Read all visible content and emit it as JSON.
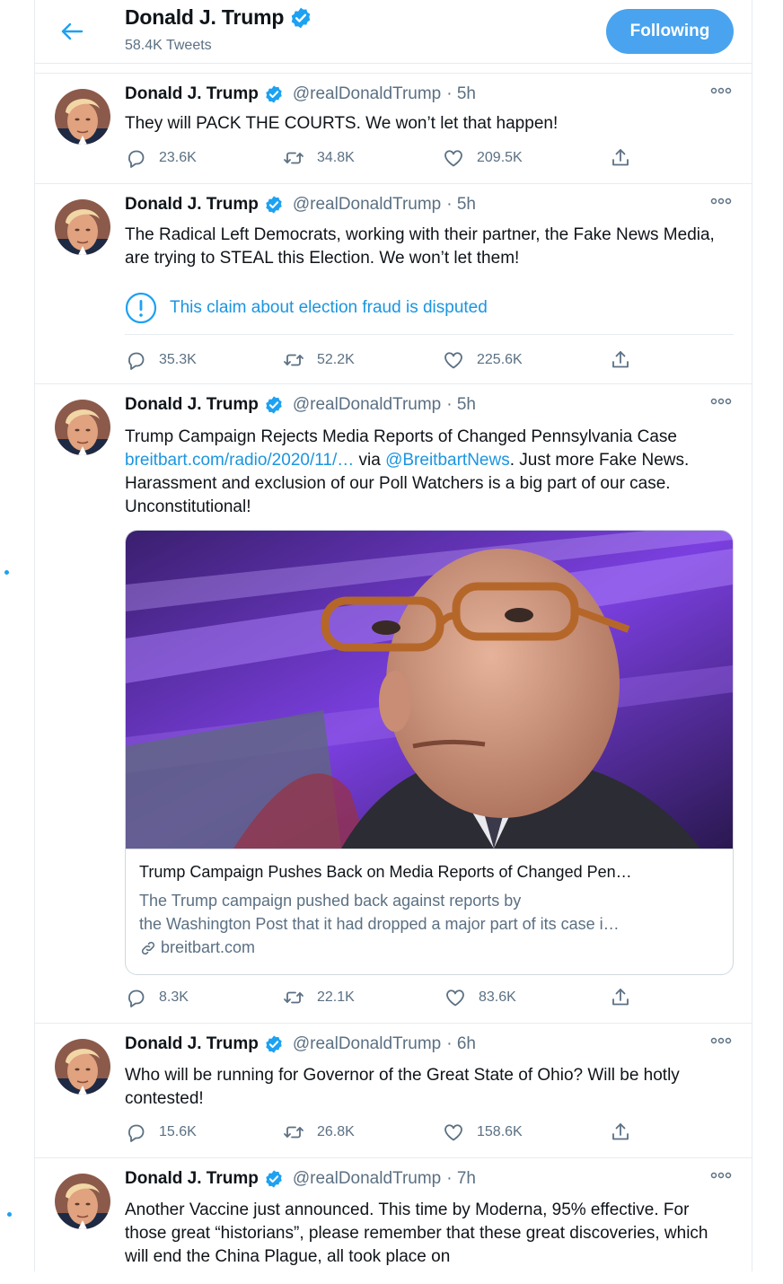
{
  "header": {
    "title": "Donald J. Trump",
    "tweet_count": "58.4K Tweets",
    "follow_label": "Following"
  },
  "colors": {
    "accent": "#1da1f2",
    "button": "#4aa3ee",
    "secondary_text": "#5b7083",
    "border": "#e6ecf0"
  },
  "icons": [
    "back-arrow-icon",
    "verified-badge-icon",
    "more-icon",
    "reply-icon",
    "retweet-icon",
    "like-icon",
    "share-icon",
    "info-icon",
    "link-icon"
  ],
  "tweets": [
    {
      "name": "Donald J. Trump",
      "handle": "@realDonaldTrump",
      "time": "· 5h",
      "text": "They will PACK THE COURTS. We won’t let that happen!",
      "replies": "23.6K",
      "retweets": "34.8K",
      "likes": "209.5K"
    },
    {
      "name": "Donald J. Trump",
      "handle": "@realDonaldTrump",
      "time": "· 5h",
      "text": "The Radical Left Democrats, working with their partner, the Fake News Media, are trying to STEAL this Election. We won’t let them!",
      "notice": "This claim about election fraud is disputed",
      "replies": "35.3K",
      "retweets": "52.2K",
      "likes": "225.6K"
    },
    {
      "name": "Donald J. Trump",
      "handle": "@realDonaldTrump",
      "time": "· 5h",
      "text_a": "Trump Campaign Rejects Media Reports of Changed Pennsylvania Case ",
      "link": "breitbart.com/radio/2020/11/…",
      "text_b": " via ",
      "mention": "@BreitbartNews",
      "text_c": ". Just more Fake News. Harassment and exclusion of our Poll Watchers is a big part of our case. Unconstitutional!",
      "card": {
        "title": "Trump Campaign Pushes Back on Media Reports of Changed Pen…",
        "desc_1": "The Trump campaign pushed back against reports by",
        "desc_2": "the Washington Post that it had dropped a major part of its case i…",
        "domain": "breitbart.com"
      },
      "replies": "8.3K",
      "retweets": "22.1K",
      "likes": "83.6K"
    },
    {
      "name": "Donald J. Trump",
      "handle": "@realDonaldTrump",
      "time": "· 6h",
      "text": "Who will be running for Governor of the Great State of Ohio? Will be hotly contested!",
      "replies": "15.6K",
      "retweets": "26.8K",
      "likes": "158.6K"
    },
    {
      "name": "Donald J. Trump",
      "handle": "@realDonaldTrump",
      "time": "· 7h",
      "text": "Another Vaccine just announced. This time by Moderna, 95% effective. For those great “historians”, please remember that these great discoveries, which will end the China Plague, all took place on"
    }
  ]
}
